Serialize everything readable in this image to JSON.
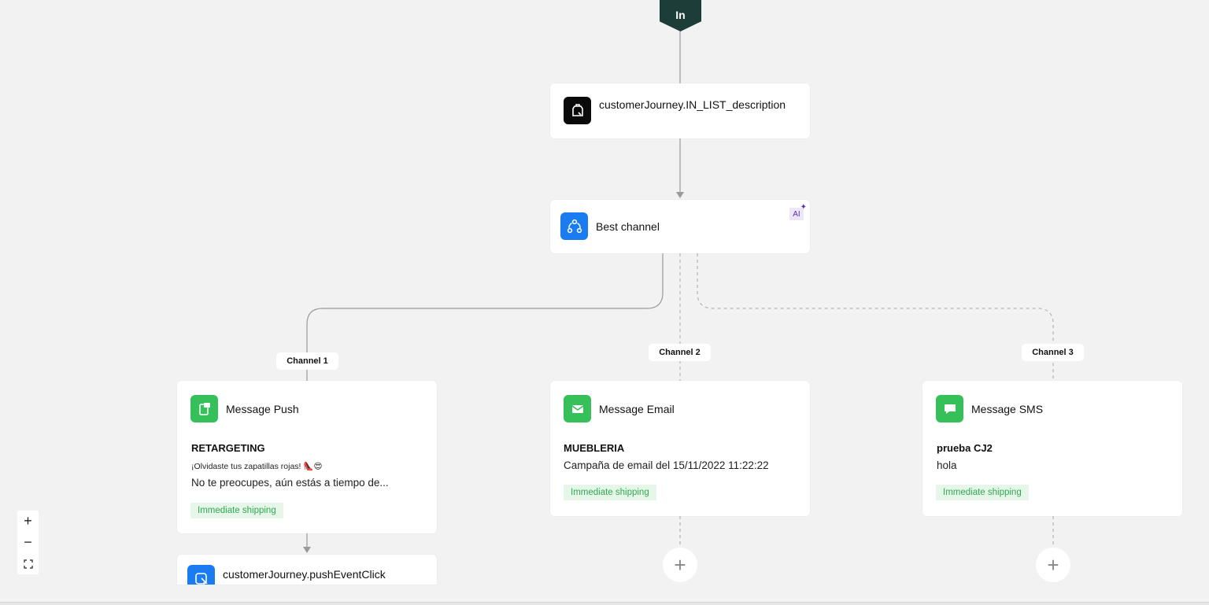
{
  "start": {
    "label": "In"
  },
  "nodes": {
    "in_list": {
      "title": "customerJourney.IN_LIST_description",
      "icon": "list-check-icon"
    },
    "best_channel": {
      "title": "Best channel",
      "icon": "channels-icon",
      "ai_label": "AI",
      "ai_icon": "sparkle-icon"
    },
    "push": {
      "title": "Message Push",
      "icon": "push-icon",
      "campaign": "RETARGETING",
      "subject": "¡Olvidaste tus zapatillas rojas! 👠😍",
      "body": "No te preocupes, aún estás a tiempo de...",
      "tag": "Immediate shipping"
    },
    "email": {
      "title": "Message Email",
      "icon": "mail-icon",
      "campaign": "MUEBLERIA",
      "body": "Campaña de email del 15/11/2022 11:22:22",
      "tag": "Immediate shipping"
    },
    "sms": {
      "title": "Message SMS",
      "icon": "chat-icon",
      "campaign": "prueba CJ2",
      "body": "hola",
      "tag": "Immediate shipping"
    },
    "push_event": {
      "title": "customerJourney.pushEventClick",
      "icon": "push-event-icon"
    }
  },
  "channels": [
    "Channel 1",
    "Channel 2",
    "Channel 3"
  ],
  "add_button": "+",
  "zoom": {
    "in": "+",
    "out": "−",
    "fit": "⛶"
  },
  "colors": {
    "start": "#1d3d38",
    "blue": "#1b7cf2",
    "green": "#35c05a",
    "tag_bg": "#e6f7ea",
    "tag_text": "#2fa851",
    "ai_bg": "#ece6f7"
  }
}
